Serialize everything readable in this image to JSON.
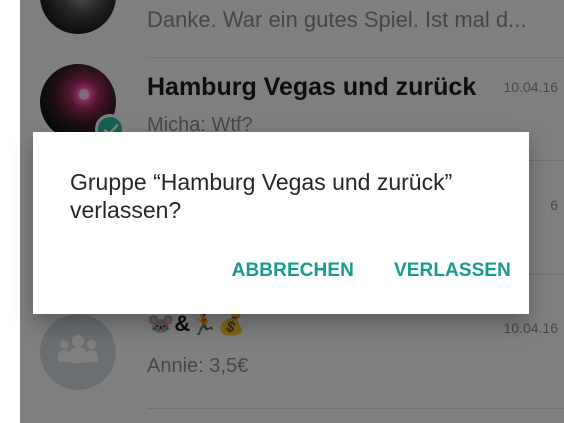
{
  "chat_list": {
    "items": [
      {
        "title": "",
        "preview": "Danke. War ein gutes Spiel. Ist mal d...",
        "date": ""
      },
      {
        "title": "Hamburg Vegas und zurück",
        "preview": "Micha: Wtf?",
        "date": "10.04.16"
      },
      {
        "title": "",
        "preview": "",
        "date": "6"
      },
      {
        "title": "🐭&🏃💰",
        "preview": "Annie: 3,5€",
        "date": "10.04.16"
      }
    ]
  },
  "dialog": {
    "message": "Gruppe “Hamburg Vegas und zurück” verlassen?",
    "cancel_label": "ABBRECHEN",
    "leave_label": "VERLASSEN"
  },
  "colors": {
    "accent": "#169b8e",
    "check_badge": "#2cbfa4",
    "scrim": "rgba(0,0,0,0.50)"
  },
  "icons": {
    "selected_badge": "check-icon",
    "group_avatar": "group-icon"
  }
}
